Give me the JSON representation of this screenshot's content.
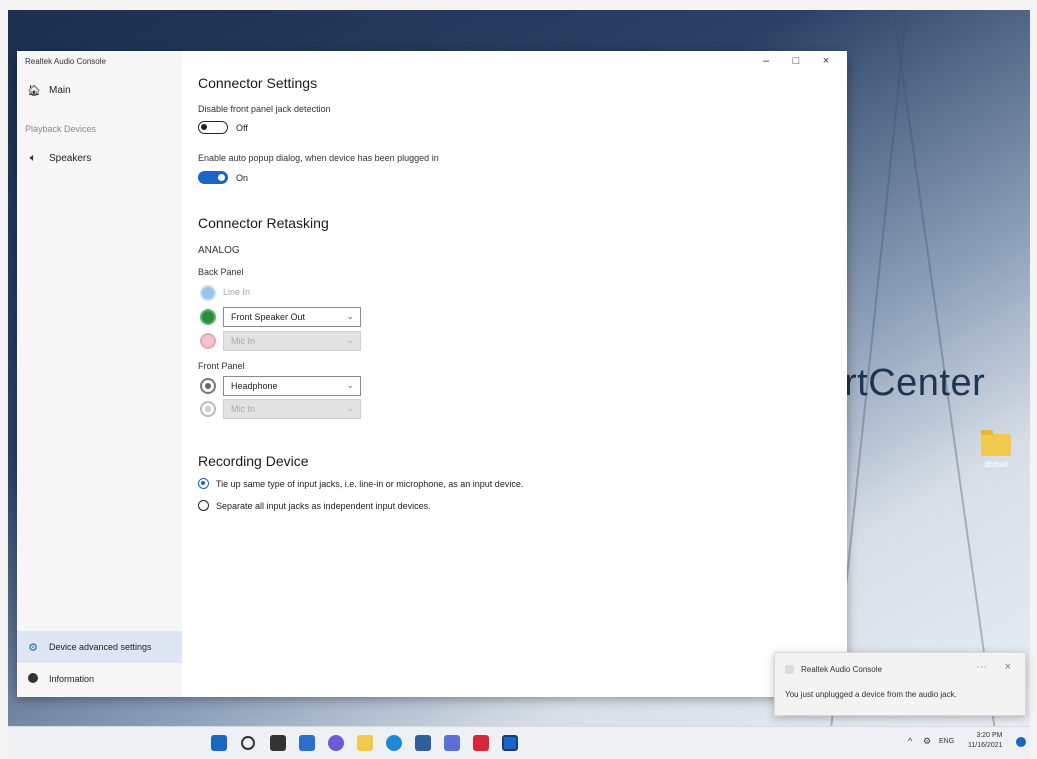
{
  "window": {
    "title": "Realtek Audio Console",
    "controls": {
      "minimize": "–",
      "maximize": "□",
      "close": "×"
    }
  },
  "sidebar": {
    "main_label": "Main",
    "section_label": "Playback Devices",
    "speakers_label": "Speakers",
    "advanced_label": "Device advanced settings",
    "info_label": "Information"
  },
  "connector_settings": {
    "heading": "Connector Settings",
    "disable_label": "Disable front panel jack detection",
    "disable_state": "Off",
    "enable_label": "Enable auto popup dialog, when device has been plugged in",
    "enable_state": "On"
  },
  "retasking": {
    "heading": "Connector Retasking",
    "analog_label": "ANALOG",
    "back_panel_label": "Back Panel",
    "back_line_in": "Line In",
    "back_green_value": "Front Speaker Out",
    "back_pink_value": "Mic In",
    "front_panel_label": "Front Panel",
    "front_headphone_value": "Headphone",
    "front_mic_value": "Mic In"
  },
  "recording": {
    "heading": "Recording Device",
    "option_tie": "Tie up same type of input jacks, i.e. line-in or microphone, as an input device.",
    "option_separate": "Separate all input jacks as independent input devices."
  },
  "desktop": {
    "wallpaper_text": "rtCenter",
    "folder_label": "dbtball"
  },
  "toast": {
    "title": "Realtek Audio Console",
    "message": "You just unplugged a device from the audio jack.",
    "close": "×",
    "menu": "···"
  },
  "taskbar": {
    "tray_chevron": "^",
    "lang": "ENG",
    "time": "3:20 PM",
    "date": "11/16/2021"
  },
  "colors": {
    "accent": "#1a66c4",
    "jack_green": "#2e8b3c",
    "jack_pink": "#f4c2cc",
    "jack_blue": "#9cc4e8"
  }
}
